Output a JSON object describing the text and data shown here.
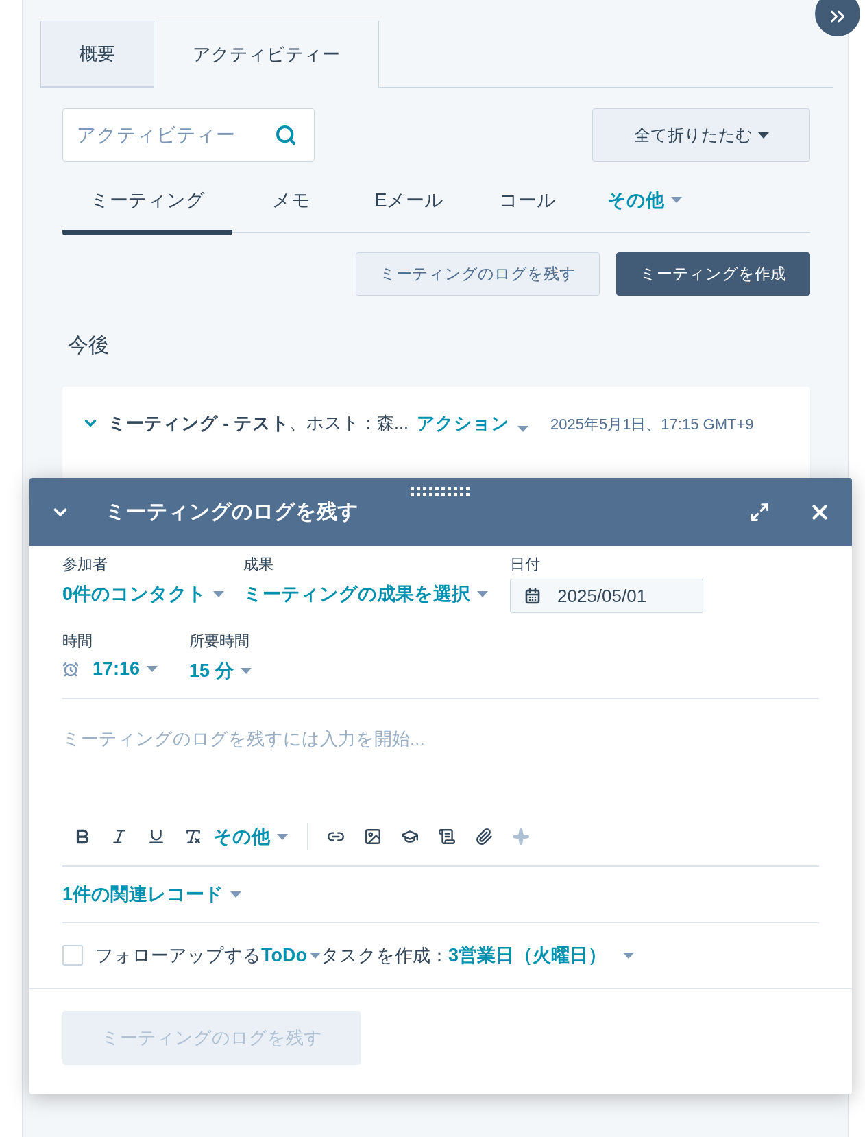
{
  "tabs": [
    {
      "label": "概要",
      "selected": false
    },
    {
      "label": "アクティビティー",
      "selected": true
    }
  ],
  "search": {
    "placeholder": "アクティビティー"
  },
  "collapse_button": "全て折りたたむ",
  "activity_tabs": [
    {
      "label": "ミーティング",
      "selected": true,
      "kind": "tab"
    },
    {
      "label": "メモ",
      "selected": false,
      "kind": "tab"
    },
    {
      "label": "Eメール",
      "selected": false,
      "kind": "tab"
    },
    {
      "label": "コール",
      "selected": false,
      "kind": "tab"
    },
    {
      "label": "その他",
      "selected": false,
      "kind": "dropdown"
    }
  ],
  "actions": [
    {
      "label": "ミーティングのログを残す",
      "kind": "secondary"
    },
    {
      "label": "ミーティングを作成",
      "kind": "primary"
    }
  ],
  "section_title": "今後",
  "activity": {
    "expanded": true,
    "title": "ミーティング - テスト",
    "host": "、ホスト：森...",
    "action": "アクション",
    "date": "2025年5月1日、17:15 GMT+9"
  },
  "dialog": {
    "title": "ミーティングのログを残す",
    "attendees": {
      "label": "参加者",
      "value": "0件のコンタクト"
    },
    "outcome": {
      "label": "成果",
      "value": "ミーティングの成果を選択"
    },
    "date": {
      "label": "日付",
      "value": "2025/05/01"
    },
    "time": {
      "label": "時間",
      "value": "17:16"
    },
    "duration": {
      "label": "所要時間",
      "value": "15 分"
    },
    "body": {
      "placeholder": "ミーティングのログを残すには入力を開始..."
    },
    "toolbar_more": "その他",
    "associations": "1件の関連レコード",
    "followup": {
      "checked": false,
      "prefix": "フォローアップする",
      "type": "ToDo",
      "middle": "タスクを作成：",
      "due": "3営業日（火曜日）"
    },
    "submit": {
      "label": "ミーティングのログを残す",
      "disabled": true
    }
  }
}
